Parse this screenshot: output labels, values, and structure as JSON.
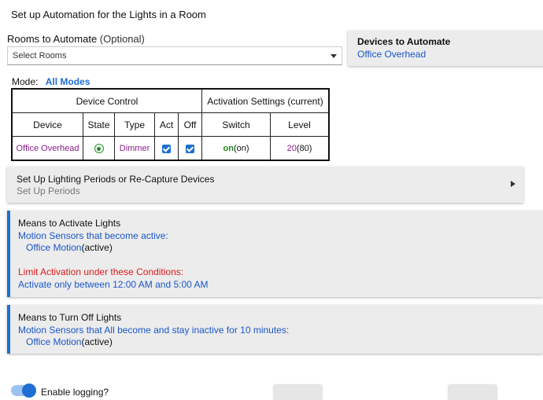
{
  "page": {
    "title": "Set up Automation for the Lights in a Room"
  },
  "rooms": {
    "label": "Rooms to Automate",
    "optional": "(Optional)",
    "placeholder": "Select Rooms"
  },
  "devices_box": {
    "heading": "Devices to Automate",
    "value": "Office Overhead"
  },
  "mode": {
    "label": "Mode:",
    "value": "All Modes"
  },
  "table": {
    "group_headers": [
      "Device Control",
      "Activation Settings (current)"
    ],
    "columns": [
      "Device",
      "State",
      "Type",
      "Act",
      "Off",
      "Switch",
      "Level"
    ],
    "rows": [
      {
        "device": "Office Overhead",
        "type": "Dimmer",
        "switch_value": "on",
        "switch_current": "(on)",
        "level_value": "20",
        "level_current": "(80)"
      }
    ]
  },
  "periods": {
    "heading": "Set Up Lighting Periods or Re-Capture Devices",
    "sub": "Set Up Periods"
  },
  "activate": {
    "heading": "Means to Activate Lights",
    "sensors_label": "Motion Sensors that become active:",
    "sensor_name": "Office Motion",
    "sensor_state": "(active)",
    "limit_label": "Limit Activation under these Conditions:",
    "limit_value": "Activate only between 12:00 AM and 5:00 AM"
  },
  "turnoff": {
    "heading": "Means to Turn Off Lights",
    "sensors_label": "Motion Sensors that All become and stay inactive for 10 minutes:",
    "sensor_name": "Office Motion",
    "sensor_state": "(active)"
  },
  "logging": {
    "label": "Enable logging?"
  },
  "colors": {
    "accent": "#1e6fd1",
    "link": "#1a56c9",
    "purple": "#8a1c8a",
    "green": "#1f8a1f",
    "red": "#e01b1b"
  }
}
